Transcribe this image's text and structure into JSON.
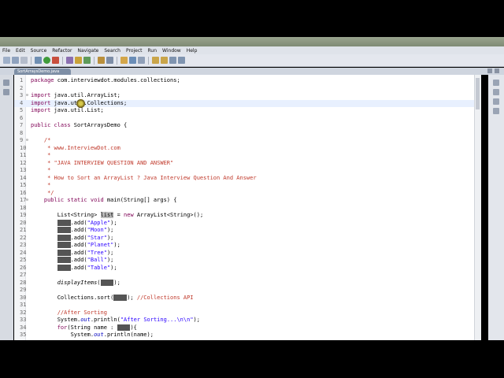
{
  "menu": [
    "File",
    "Edit",
    "Source",
    "Refactor",
    "Navigate",
    "Search",
    "Project",
    "Run",
    "Window",
    "Help"
  ],
  "tab": {
    "title": "SortArraysDemo.java"
  },
  "lines": [
    {
      "n": "1",
      "t": "package com.interviewdot.modules.collections;",
      "k": "pkg"
    },
    {
      "n": "2",
      "t": ""
    },
    {
      "n": "3",
      "t": "import java.util.ArrayList;",
      "k": "imp",
      "fold": "⊖"
    },
    {
      "n": "4",
      "t": "import java.util.Collections;",
      "k": "imp",
      "current": true
    },
    {
      "n": "5",
      "t": "import java.util.List;",
      "k": "imp"
    },
    {
      "n": "6",
      "t": ""
    },
    {
      "n": "7",
      "t": "public class SortArraysDemo {",
      "k": "cls"
    },
    {
      "n": "8",
      "t": ""
    },
    {
      "n": "9",
      "t": "    /*",
      "k": "doc",
      "fold": "⊖"
    },
    {
      "n": "10",
      "t": "     * www.InterviewDot.com",
      "k": "doc"
    },
    {
      "n": "11",
      "t": "     *",
      "k": "doc"
    },
    {
      "n": "12",
      "t": "     * \"JAVA INTERVIEW QUESTION AND ANSWER\"",
      "k": "doc"
    },
    {
      "n": "13",
      "t": "     *",
      "k": "doc"
    },
    {
      "n": "14",
      "t": "     * How to Sort an ArrayList ? Java Interview Question And Answer",
      "k": "doc"
    },
    {
      "n": "15",
      "t": "     *",
      "k": "doc"
    },
    {
      "n": "16",
      "t": "     */",
      "k": "doc"
    },
    {
      "n": "17",
      "t": "    public static void main(String[] args) {",
      "k": "main",
      "fold": "⊖"
    },
    {
      "n": "18",
      "t": ""
    },
    {
      "n": "19",
      "t": "        List<String> list = new ArrayList<String>();",
      "k": "decl"
    },
    {
      "n": "20",
      "t": "        list.add(\"Apple\");",
      "k": "add",
      "arg": "\"Apple\""
    },
    {
      "n": "21",
      "t": "        list.add(\"Moon\");",
      "k": "add",
      "arg": "\"Moon\""
    },
    {
      "n": "22",
      "t": "        list.add(\"Star\");",
      "k": "add",
      "arg": "\"Star\""
    },
    {
      "n": "23",
      "t": "        list.add(\"Planet\");",
      "k": "add",
      "arg": "\"Planet\""
    },
    {
      "n": "24",
      "t": "        list.add(\"Tree\");",
      "k": "add",
      "arg": "\"Tree\""
    },
    {
      "n": "25",
      "t": "        list.add(\"Ball\");",
      "k": "add",
      "arg": "\"Ball\""
    },
    {
      "n": "26",
      "t": "        list.add(\"Table\");",
      "k": "add",
      "arg": "\"Table\""
    },
    {
      "n": "27",
      "t": ""
    },
    {
      "n": "28",
      "t": "        displayItems(list);",
      "k": "disp"
    },
    {
      "n": "29",
      "t": ""
    },
    {
      "n": "30",
      "t": "        Collections.sort(list); //Collections API",
      "k": "sort"
    },
    {
      "n": "31",
      "t": ""
    },
    {
      "n": "32",
      "t": "        //After Sorting",
      "k": "cmt"
    },
    {
      "n": "33",
      "t": "        System.out.println(\"After Sorting...\\n\\n\");",
      "k": "print"
    },
    {
      "n": "34",
      "t": "        for(String name : list){",
      "k": "for"
    },
    {
      "n": "35",
      "t": "            System.out.println(name);",
      "k": "plain"
    }
  ]
}
